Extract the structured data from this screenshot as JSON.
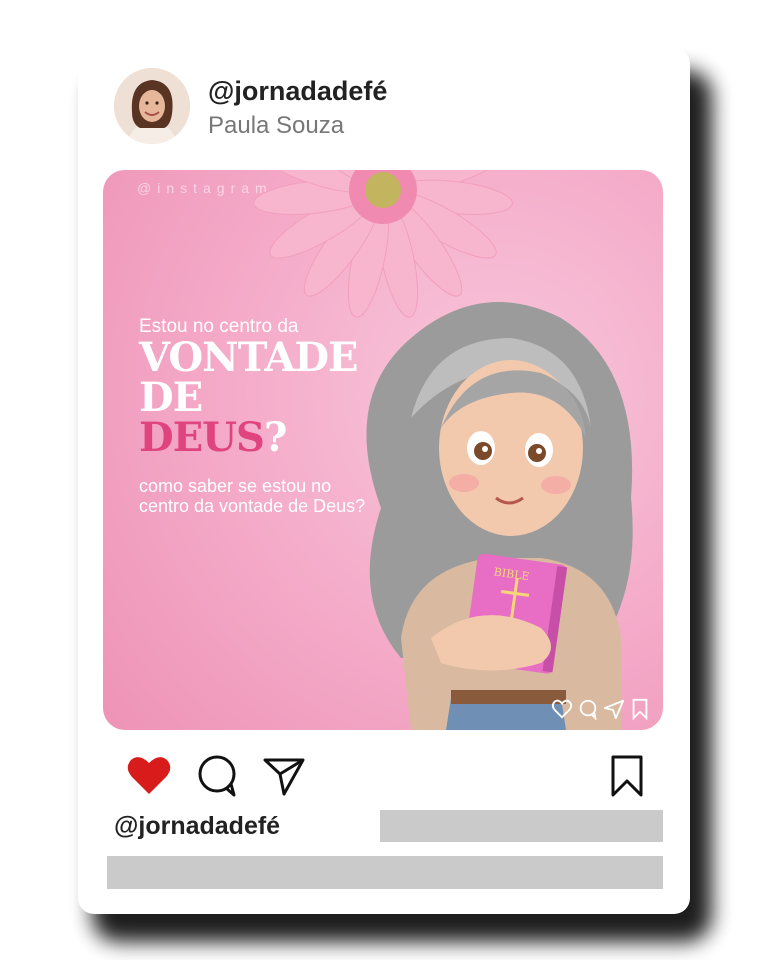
{
  "profile": {
    "handle": "@jornadadefé",
    "name": "Paula Souza",
    "avatar_icon": "avatar-photo"
  },
  "post": {
    "watermark": "@instagram",
    "kicker": "Estou no centro da",
    "headline_1": "VONTADE",
    "headline_2": "DE",
    "headline_3": "DEUS",
    "headline_mark": "?",
    "subtitle": "como saber se estou no centro da vontade de Deus?",
    "book_label": "BIBLE",
    "mini_icons": [
      "heart-outline-icon",
      "comment-icon",
      "share-icon",
      "bookmark-icon"
    ]
  },
  "actions": {
    "like_icon": "heart-filled-icon",
    "comment_icon": "comment-icon",
    "share_icon": "send-icon",
    "save_icon": "bookmark-icon"
  },
  "footer": {
    "handle": "@jornadadefé"
  },
  "colors": {
    "accent_pink": "#e0447e",
    "post_bg": "#f4a9c7",
    "like_red": "#d81b1b",
    "placeholder_bar": "#cacaca"
  }
}
